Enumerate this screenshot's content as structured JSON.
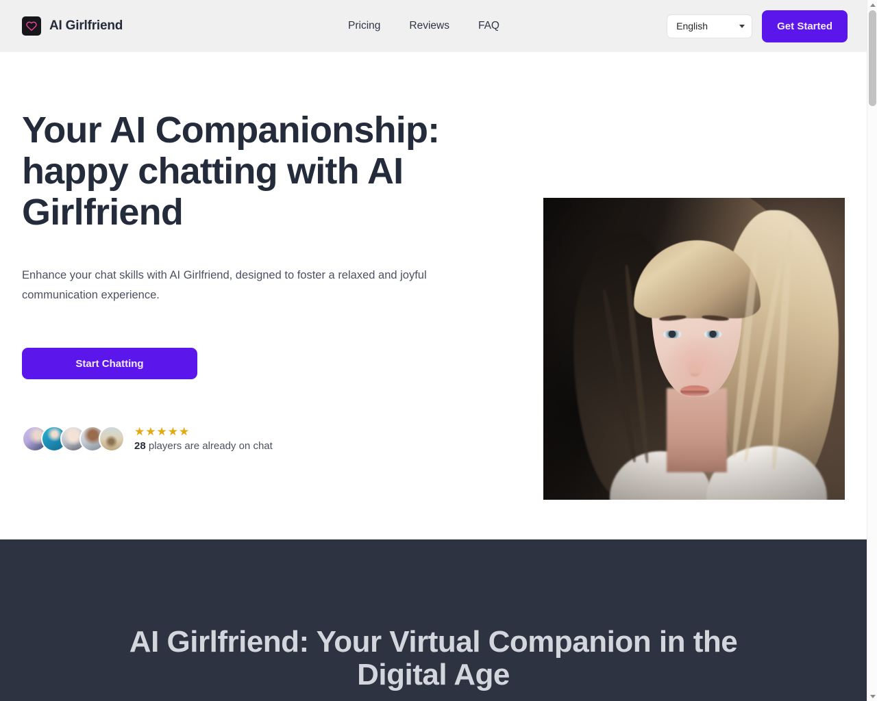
{
  "header": {
    "brand": {
      "name": "AI Girlfriend",
      "logo_icon": "heart-icon"
    },
    "nav": [
      {
        "label": "Pricing"
      },
      {
        "label": "Reviews"
      },
      {
        "label": "FAQ"
      }
    ],
    "language_select": {
      "value": "English",
      "caret_icon": "chevron-down-icon"
    },
    "cta_label": "Get Started"
  },
  "hero": {
    "title": "Your AI Companionship: happy chatting with AI Girlfriend",
    "subtitle": "Enhance your chat skills with AI Girlfriend, designed to foster a relaxed and joyful communication experience.",
    "cta_label": "Start Chatting",
    "social_proof": {
      "stars": "★★★★★",
      "star_count": 5,
      "count": "28",
      "text": " players are already on chat",
      "avatars": [
        {
          "alt": "user-avatar-1"
        },
        {
          "alt": "user-avatar-2"
        },
        {
          "alt": "user-avatar-3"
        },
        {
          "alt": "user-avatar-4"
        },
        {
          "alt": "user-avatar-5"
        }
      ]
    },
    "image_alt": "AI girlfriend portrait illustration"
  },
  "dark_section": {
    "title": "AI Girlfriend: Your Virtual Companion in the Digital Age"
  },
  "colors": {
    "accent_purple": "#5b16ec",
    "header_bg": "#f0f0f0",
    "dark_bg": "#2d3341",
    "heading": "#242c3c",
    "star_gold": "#e5a812",
    "dark_section_text": "#d3d7dd"
  }
}
